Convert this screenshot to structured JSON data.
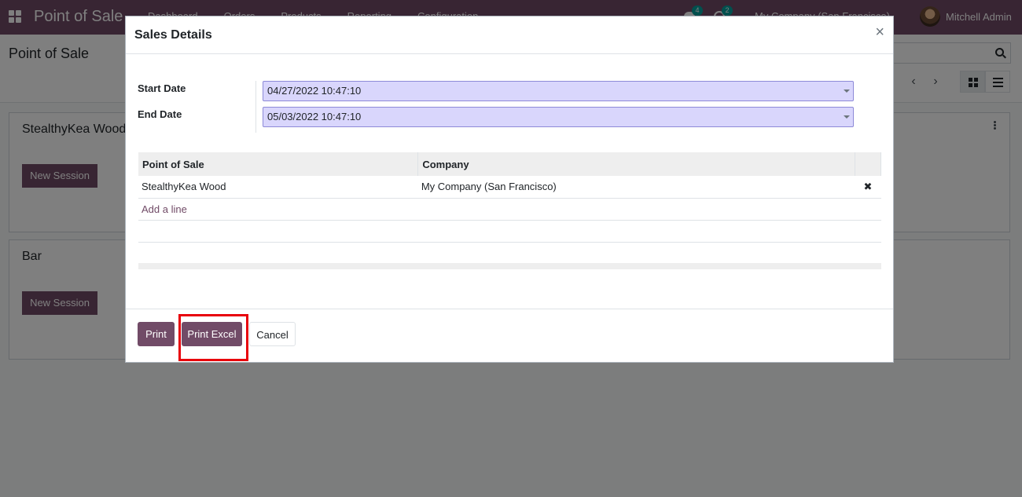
{
  "navbar": {
    "brand": "Point of Sale",
    "menu": [
      "Dashboard",
      "Orders",
      "Products",
      "Reporting",
      "Configuration"
    ],
    "messages_count": "4",
    "activities_count": "2",
    "company": "My Company (San Francisco)",
    "user": "Mitchell Admin"
  },
  "control_panel": {
    "title": "Point of Sale"
  },
  "kanban": {
    "cards": [
      {
        "title": "StealthyKea Wood",
        "button": "New Session"
      },
      {
        "title": "Bar",
        "button": "New Session"
      }
    ]
  },
  "modal": {
    "title": "Sales Details",
    "start_date_label": "Start Date",
    "start_date_value": "04/27/2022 10:47:10",
    "end_date_label": "End Date",
    "end_date_value": "05/03/2022 10:47:10",
    "table": {
      "headers": [
        "Point of Sale",
        "Company"
      ],
      "rows": [
        {
          "pos": "StealthyKea Wood",
          "company": "My Company (San Francisco)"
        }
      ],
      "add_line": "Add a line"
    },
    "buttons": {
      "print": "Print",
      "print_excel": "Print Excel",
      "cancel": "Cancel"
    }
  },
  "colors": {
    "brand": "#714b67",
    "date_input_bg": "#d9d6fc",
    "highlight": "#e8000b"
  }
}
